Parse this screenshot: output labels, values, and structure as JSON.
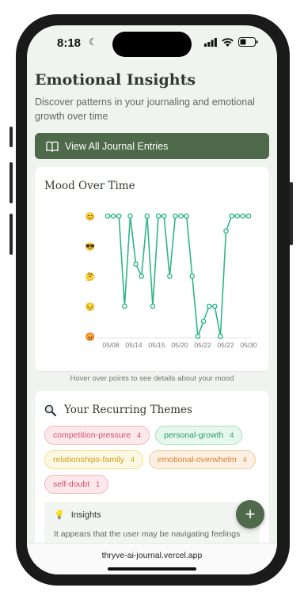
{
  "status": {
    "time": "8:18"
  },
  "header": {
    "title": "Emotional Insights",
    "subtitle_line1": "Discover patterns in your journaling and emotional",
    "subtitle_line2": "growth over time"
  },
  "cta": {
    "label": "View All Journal Entries"
  },
  "mood_chart": {
    "title": "Mood Over Time",
    "hint": "Hover over points to see details about your mood"
  },
  "chart_data": {
    "type": "line",
    "y_levels": [
      "😊",
      "😎",
      "🤔",
      "😔",
      "😡"
    ],
    "ylim": [
      0,
      4
    ],
    "x_tick_labels": [
      "05/08",
      "05/14",
      "05/15",
      "05/20",
      "05/22",
      "05/22",
      "05/30"
    ],
    "series": [
      {
        "values": [
          4,
          4,
          4,
          1,
          4,
          2.4,
          2,
          4,
          1,
          4,
          4,
          2,
          4,
          4,
          4,
          2,
          0,
          0.5,
          1,
          1,
          0,
          3.5,
          4,
          4,
          4,
          4
        ]
      }
    ],
    "color": "#2fb58a"
  },
  "themes": {
    "title": "Your Recurring Themes",
    "items": [
      {
        "label": "competition-pressure",
        "count": "4"
      },
      {
        "label": "personal-growth",
        "count": "4"
      },
      {
        "label": "relationships-family",
        "count": "4"
      },
      {
        "label": "emotional-overwhelm",
        "count": "4"
      },
      {
        "label": "self-doubt",
        "count": "1"
      }
    ]
  },
  "insights": {
    "title": "Insights",
    "text": "It appears that the user may be navigating feelings"
  },
  "browser": {
    "url": "thryve-ai-journal.vercel.app"
  }
}
